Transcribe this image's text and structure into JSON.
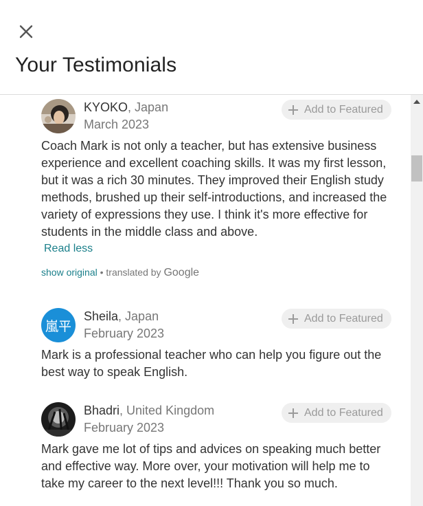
{
  "header": {
    "title": "Your Testimonials",
    "close_icon": "close-icon"
  },
  "colors": {
    "link": "#1a7f8a",
    "muted": "#777777",
    "button_bg": "#efefef",
    "avatar_sheila_bg": "#1a8fd8"
  },
  "feature_button": {
    "label": "Add to Featured",
    "icon": "plus-icon"
  },
  "testimonials": [
    {
      "name": "KYOKO",
      "country": ", Japan",
      "date": "March 2023",
      "text": "Coach Mark is not only a teacher, but has extensive business experience and excellent coaching skills. It was my first lesson, but it was a rich 30 minutes. They improved their English study methods, brushed up their self-introductions, and increased the variety of expressions they use. I think it's more effective for students in the middle class and above.",
      "read_less": "Read less",
      "show_original": "show original",
      "translated_by": " • translated by ",
      "google": "Google"
    },
    {
      "name": "Sheila",
      "country": ", Japan",
      "date": "February 2023",
      "avatar_text": "嵐平",
      "text": "Mark is a professional teacher who can help you figure out the best way to speak English."
    },
    {
      "name": "Bhadri",
      "country": ", United Kingdom",
      "date": "February 2023",
      "text": "Mark gave me lot of tips and advices on speaking much better and effective way. More over, your motivation will help me to take my career to the next level!!! Thank you so much."
    }
  ]
}
